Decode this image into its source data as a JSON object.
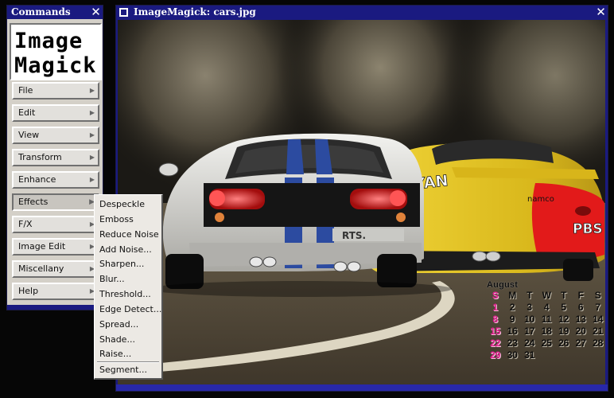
{
  "commands_window": {
    "title": "Commands",
    "close_glyph": "✕",
    "logo_text_line1": "Image",
    "logo_text_line2": "Magick",
    "menu_arrow": "▶",
    "buttons": [
      {
        "label": "File"
      },
      {
        "label": "Edit"
      },
      {
        "label": "View"
      },
      {
        "label": "Transform"
      },
      {
        "label": "Enhance"
      },
      {
        "label": "Effects",
        "pressed": true
      },
      {
        "label": "F/X"
      },
      {
        "label": "Image Edit"
      },
      {
        "label": "Miscellany"
      },
      {
        "label": "Help"
      }
    ]
  },
  "image_window": {
    "title": "ImageMagick: cars.jpg",
    "close_glyph": "✕"
  },
  "effects_menu": {
    "items": [
      "Despeckle",
      "Emboss",
      "Reduce Noise",
      "Add Noise...",
      "Sharpen...",
      "Blur...",
      "Threshold...",
      "Edge Detect...",
      "Spread...",
      "Shade...",
      "Raise..."
    ],
    "last_item": "Segment..."
  },
  "photo": {
    "car_left_plate": "RTS.",
    "car_right_text": "SYAN",
    "car_right_sponsor": "namco",
    "car_right_tail": "PBS"
  },
  "calendar": {
    "month": "August",
    "weekdays": [
      "S",
      "M",
      "T",
      "W",
      "T",
      "F",
      "S"
    ],
    "weeks": [
      [
        "1",
        "2",
        "3",
        "4",
        "5",
        "6",
        "7"
      ],
      [
        "8",
        "9",
        "10",
        "11",
        "12",
        "13",
        "14"
      ],
      [
        "15",
        "16",
        "17",
        "18",
        "19",
        "20",
        "21"
      ],
      [
        "22",
        "23",
        "24",
        "25",
        "26",
        "27",
        "28"
      ],
      [
        "29",
        "30",
        "31",
        "",
        "",
        "",
        ""
      ]
    ]
  },
  "colors": {
    "titlebar": "#1a1a80",
    "panel": "#d4d0c8",
    "sunday_pink": "#e0208e",
    "car_yellow": "#e2c020",
    "car_white": "#d9d9d6",
    "stripe_blue": "#2c4ba0"
  }
}
